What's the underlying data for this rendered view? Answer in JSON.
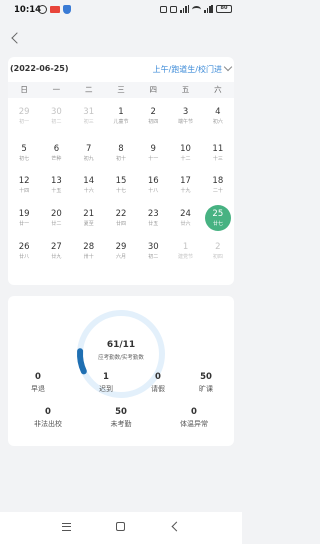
{
  "status_bar": {
    "time": "10:14",
    "battery": "80"
  },
  "calendar": {
    "selected_date": "(2022-06-25)",
    "filter": "上午/跑道生/校门进",
    "weekdays": [
      "日",
      "一",
      "二",
      "三",
      "四",
      "五",
      "六"
    ],
    "weeks": [
      [
        {
          "d": "29",
          "l": "初一",
          "dim": true
        },
        {
          "d": "30",
          "l": "初二",
          "dim": true
        },
        {
          "d": "31",
          "l": "初三",
          "dim": true
        },
        {
          "d": "1",
          "l": "儿童节"
        },
        {
          "d": "2",
          "l": "初四"
        },
        {
          "d": "3",
          "l": "端午节"
        },
        {
          "d": "4",
          "l": "初六"
        }
      ],
      [
        {
          "d": "5",
          "l": "初七"
        },
        {
          "d": "6",
          "l": "芒种"
        },
        {
          "d": "7",
          "l": "初九"
        },
        {
          "d": "8",
          "l": "初十"
        },
        {
          "d": "9",
          "l": "十一"
        },
        {
          "d": "10",
          "l": "十二"
        },
        {
          "d": "11",
          "l": "十三"
        }
      ],
      [
        {
          "d": "12",
          "l": "十四"
        },
        {
          "d": "13",
          "l": "十五"
        },
        {
          "d": "14",
          "l": "十六"
        },
        {
          "d": "15",
          "l": "十七"
        },
        {
          "d": "16",
          "l": "十八"
        },
        {
          "d": "17",
          "l": "十九"
        },
        {
          "d": "18",
          "l": "二十"
        }
      ],
      [
        {
          "d": "19",
          "l": "廿一"
        },
        {
          "d": "20",
          "l": "廿二"
        },
        {
          "d": "21",
          "l": "夏至"
        },
        {
          "d": "22",
          "l": "廿四"
        },
        {
          "d": "23",
          "l": "廿五"
        },
        {
          "d": "24",
          "l": "廿六"
        },
        {
          "d": "25",
          "l": "廿七",
          "sel": true
        }
      ],
      [
        {
          "d": "26",
          "l": "廿八"
        },
        {
          "d": "27",
          "l": "廿九"
        },
        {
          "d": "28",
          "l": "卅十"
        },
        {
          "d": "29",
          "l": "六月"
        },
        {
          "d": "30",
          "l": "初二"
        },
        {
          "d": "1",
          "l": "建党节",
          "dim": true
        },
        {
          "d": "2",
          "l": "初四",
          "dim": true
        }
      ]
    ]
  },
  "summary": {
    "ring_value": "61/11",
    "ring_label": "应考勤数/实考勤数",
    "ring_fraction": 0.08,
    "colors": {
      "ring_track": "#e3f0fb",
      "ring_fill": "#1f6fb2",
      "selected_day": "#47b282",
      "filter_text": "#3d8bd8"
    },
    "stats": [
      {
        "value": "0",
        "label": "早退"
      },
      {
        "value": "1",
        "label": "迟到"
      },
      {
        "value": "0",
        "label": "请假"
      },
      {
        "value": "50",
        "label": "旷课"
      },
      {
        "value": "0",
        "label": "非法出校"
      },
      {
        "value": "50",
        "label": "未考勤"
      },
      {
        "value": "0",
        "label": "体温异常"
      }
    ]
  }
}
